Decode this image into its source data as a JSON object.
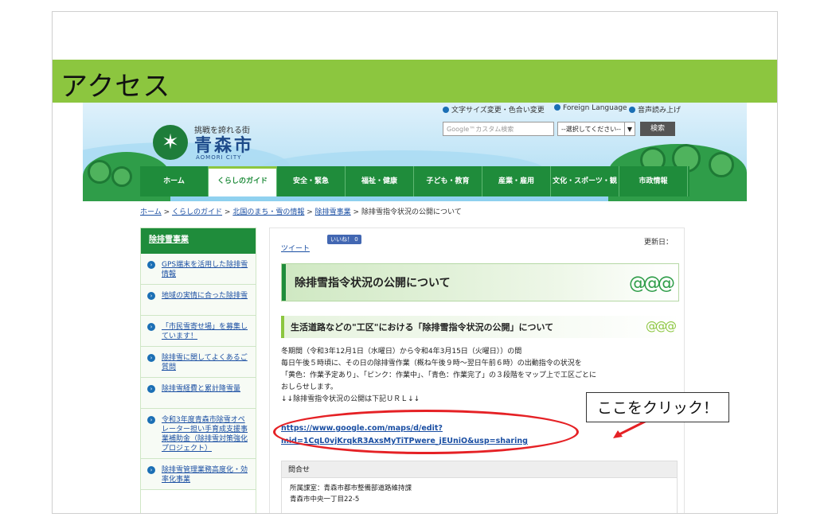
{
  "slide_title": "アクセス",
  "utility": {
    "font_size": "文字サイズ変更・色合い変更",
    "foreign_language": "Foreign Language",
    "voice": "音声読み上げ"
  },
  "logo": {
    "tagline": "挑戦を誇れる街",
    "name": "青森市",
    "name_en": "AOMORI CITY"
  },
  "search": {
    "placeholder": "Google™カスタム検索",
    "select_value": "--選択してください--",
    "button": "検索"
  },
  "nav": [
    {
      "label": "ホーム"
    },
    {
      "label": "くらしのガイド"
    },
    {
      "label": "安全・緊急"
    },
    {
      "label": "福祉・健康"
    },
    {
      "label": "子ども・教育"
    },
    {
      "label": "産業・雇用"
    },
    {
      "label": "文化・スポーツ・観光"
    },
    {
      "label": "市政情報"
    }
  ],
  "breadcrumb": {
    "items": [
      "ホーム",
      "くらしのガイド",
      "北国のまち・雪の情報",
      "除排雪事業"
    ],
    "current": "除排雪指令状況の公開について",
    "sep": ">"
  },
  "sidebar": {
    "title": "除排雪事業",
    "items": [
      {
        "label": "GPS端末を活用した除排雪情報"
      },
      {
        "label": "地域の実情に合った除排雪"
      },
      {
        "label": "「市民雪寄せ場」を募集しています！"
      },
      {
        "label": "除排雪に関してよくあるご質問"
      },
      {
        "label": "除排雪経費と累計降雪量"
      },
      {
        "label": "令和3年度青森市除雪オペレーター担い手育成支援事業補助金（除排雪対策強化プロジェクト）"
      },
      {
        "label": "除排雪管理業務高度化・効率化事業"
      }
    ]
  },
  "content": {
    "tweet": "ツイート",
    "like": "いいね！ 0",
    "updated": "更新日：",
    "heading": "除排雪指令状況の公開について",
    "subheading": "生活道路などの\"工区\"における「除排雪指令状況の公開」について",
    "paragraph": [
      "冬期間（令和3年12月1日（水曜日）から令和4年3月15日（火曜日））の間",
      "毎日午後５時頃に、その日の除排雪作業（概ね午後９時～翌日午前６時）の出動指令の状況を",
      "「黄色：作業予定あり」、「ピンク：作業中」、「青色：作業完了」の３段階をマップ上で工区ごとに",
      "おしらせします。",
      "↓↓除排雪指令状況の公開は下記ＵＲＬ↓↓"
    ],
    "link_line1": "https://www.google.com/maps/d/edit?",
    "link_line2": "mid=1CqL0vjKrqkR3AxsMyTiTPwere_jEUniO&usp=sharing",
    "contact_head": "問合せ",
    "contact_lines": [
      "所属課室：青森市都市整備部道路維持課",
      "青森市中央一丁目22-5"
    ]
  },
  "callout": "ここをクリック！",
  "colors": {
    "banner": "#8cc63f",
    "nav_green": "#1f8c3b",
    "highlight_red": "#e52125",
    "link_blue": "#1b4fa3"
  }
}
